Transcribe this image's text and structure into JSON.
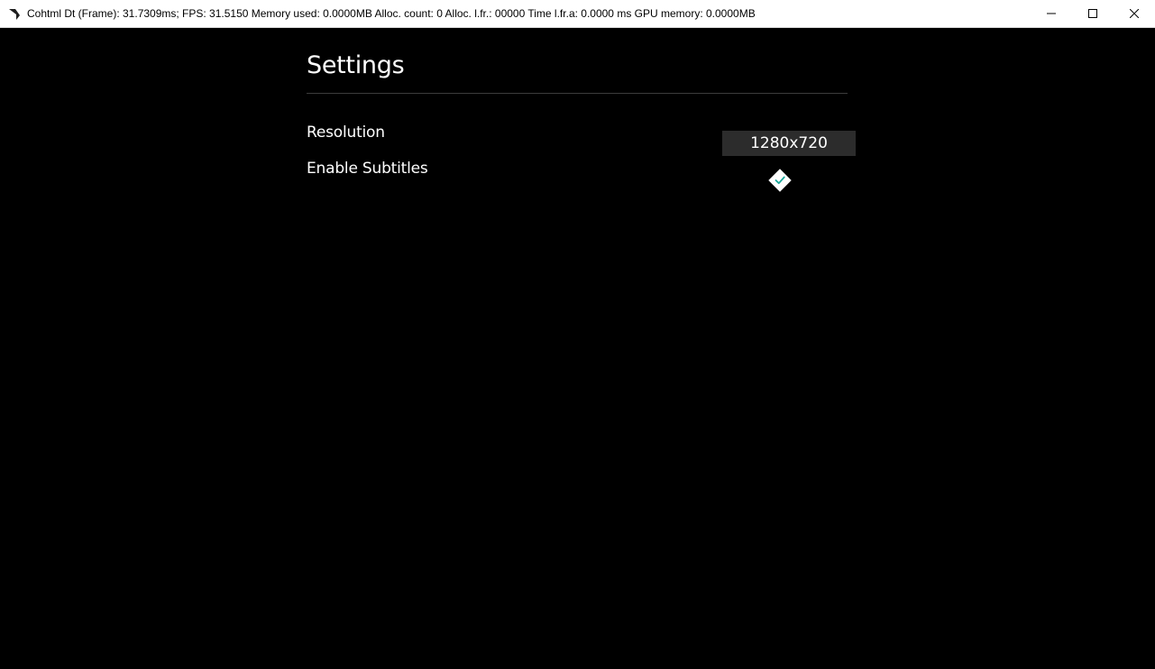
{
  "window": {
    "title": "Cohtml Dt (Frame): 31.7309ms; FPS: 31.5150 Memory used: 0.0000MB Alloc. count: 0 Alloc. l.fr.: 00000 Time l.fr.a: 0.0000 ms GPU memory: 0.0000MB",
    "icon": "app-logo-icon",
    "controls": {
      "minimize_icon": "minimize-icon",
      "maximize_icon": "maximize-icon",
      "close_icon": "close-icon"
    }
  },
  "settings": {
    "title": "Settings",
    "resolution": {
      "label": "Resolution",
      "value": "1280x720"
    },
    "subtitles": {
      "label": "Enable Subtitles",
      "checked": true,
      "icon": "checkmark-icon"
    }
  },
  "colors": {
    "background": "#000000",
    "text": "#ffffff",
    "select_background": "#2c2c2c",
    "divider": "#3c3c3c",
    "check_accent": "#1aa89a"
  }
}
